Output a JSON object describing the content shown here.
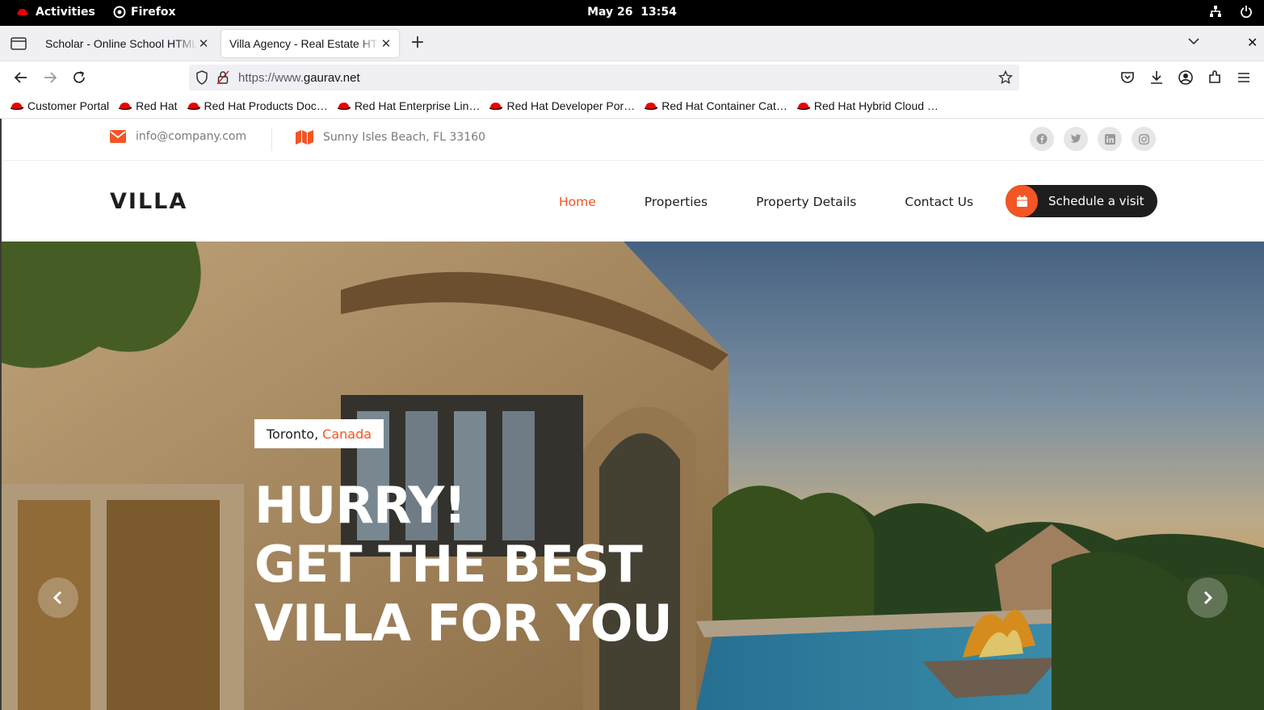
{
  "system_bar": {
    "activities": "Activities",
    "app": "Firefox",
    "date": "May 26",
    "time": "13:54"
  },
  "tabs": [
    {
      "title": "Scholar - Online School HTML5 Template",
      "active": false
    },
    {
      "title": "Villa Agency - Real Estate HTML5 Template",
      "active": true
    }
  ],
  "urlbar": {
    "prefix": "https://www.",
    "domain": "gaurav.net"
  },
  "bookmarks": [
    "Customer Portal",
    "Red Hat",
    "Red Hat Products Doc…",
    "Red Hat Enterprise Lin…",
    "Red Hat Developer Por…",
    "Red Hat Container Cat…",
    "Red Hat Hybrid Cloud …"
  ],
  "site": {
    "email": "info@company.com",
    "address": "Sunny Isles Beach, FL 33160",
    "logo": "VILLA",
    "nav": [
      "Home",
      "Properties",
      "Property Details",
      "Contact Us"
    ],
    "nav_active": "Home",
    "cta": "Schedule a visit",
    "hero": {
      "city": "Toronto,",
      "country": "Canada",
      "line1": "HURRY!",
      "line2": "GET THE BEST",
      "line3": "VILLA FOR YOU"
    }
  },
  "colors": {
    "accent": "#f35525",
    "dark": "#1e1e1e"
  },
  "icons": {
    "email": "envelope-icon",
    "address": "map-icon",
    "socials": [
      "facebook-icon",
      "twitter-icon",
      "linkedin-icon",
      "instagram-icon"
    ]
  }
}
